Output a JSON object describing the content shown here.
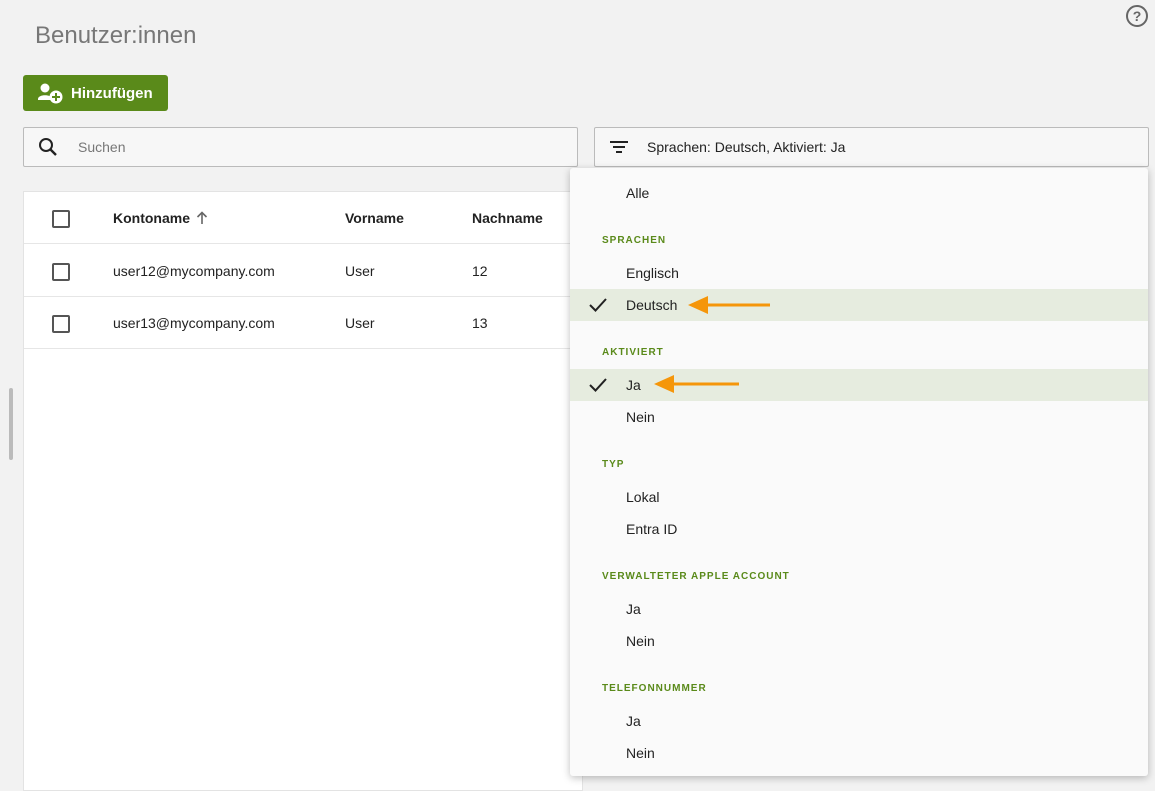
{
  "page": {
    "title": "Benutzer:innen",
    "help_icon": "help-circle-icon"
  },
  "toolbar": {
    "add_label": "Hinzufügen",
    "add_icon": "add-user-icon",
    "search_placeholder": "Suchen",
    "search_icon": "search-icon",
    "filter_icon": "filter-icon",
    "filter_text": "Sprachen: Deutsch, Aktiviert: Ja"
  },
  "table": {
    "columns": [
      "Kontoname",
      "Vorname",
      "Nachname"
    ],
    "sort_column": "Kontoname",
    "sort_icon": "arrow-up-icon",
    "rows": [
      {
        "account": "user12@mycompany.com",
        "first": "User",
        "last": "12"
      },
      {
        "account": "user13@mycompany.com",
        "first": "User",
        "last": "13"
      }
    ]
  },
  "filter_menu": {
    "all_label": "Alle",
    "groups": [
      {
        "heading": "SPRACHEN",
        "items": [
          {
            "label": "Englisch",
            "selected": false
          },
          {
            "label": "Deutsch",
            "selected": true
          }
        ]
      },
      {
        "heading": "AKTIVIERT",
        "items": [
          {
            "label": "Ja",
            "selected": true
          },
          {
            "label": "Nein",
            "selected": false
          }
        ]
      },
      {
        "heading": "TYP",
        "items": [
          {
            "label": "Lokal",
            "selected": false
          },
          {
            "label": "Entra ID",
            "selected": false
          }
        ]
      },
      {
        "heading": "VERWALTETER APPLE ACCOUNT",
        "items": [
          {
            "label": "Ja",
            "selected": false
          },
          {
            "label": "Nein",
            "selected": false
          }
        ]
      },
      {
        "heading": "TELEFONNUMMER",
        "items": [
          {
            "label": "Ja",
            "selected": false
          },
          {
            "label": "Nein",
            "selected": false
          }
        ]
      }
    ]
  },
  "colors": {
    "accent": "#5a8a1a",
    "selected_bg": "#e6ecdf",
    "annotation_arrow": "#f5960a"
  }
}
